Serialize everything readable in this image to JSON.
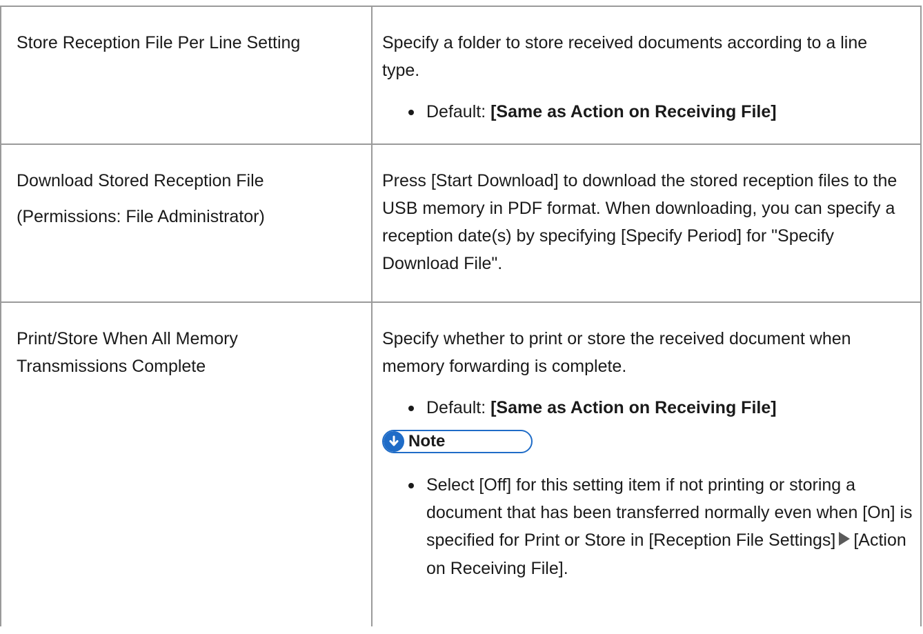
{
  "rows": [
    {
      "setting": "Store Reception File Per Line Setting",
      "description": "Specify a folder to store received documents according to a line type.",
      "default_prefix": "Default: ",
      "default_value": "[Same as Action on Receiving File]"
    },
    {
      "setting": "Download Stored Reception File",
      "permissions": "(Permissions: File Administrator)",
      "description": "Press [Start Download] to download the stored reception files to the USB memory in PDF format. When downloading, you can specify a reception date(s) by specifying [Specify Period] for \"Specify Download File\"."
    },
    {
      "setting": "Print/Store When All Memory Transmissions Complete",
      "description": "Specify whether to print or store the received document when memory forwarding is complete.",
      "default_prefix": "Default: ",
      "default_value": "[Same as Action on Receiving File]",
      "note_label": "Note",
      "note_text_before": "Select [Off] for this setting item if not printing or storing a document that has been transferred normally even when [On] is specified for Print or Store in [Reception File Settings]",
      "note_text_after": "[Action on Receiving File]."
    }
  ],
  "colors": {
    "border": "#9a9a9a",
    "note_accent": "#1f6cc7",
    "text": "#1a1a1a"
  },
  "icons": {
    "note_icon": "down-arrow-circle-icon",
    "menu_arrow": "right-triangle-icon"
  }
}
